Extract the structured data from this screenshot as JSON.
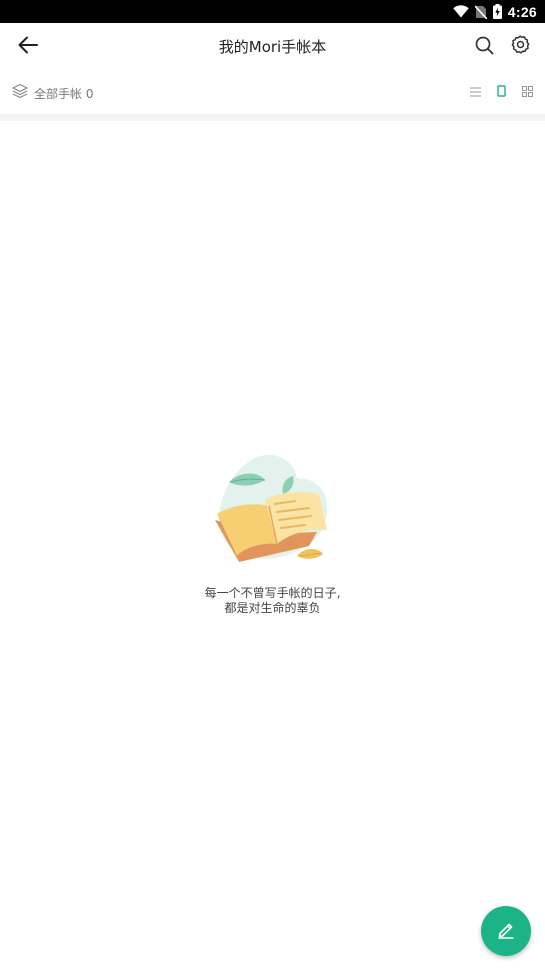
{
  "status_bar": {
    "time": "4:26",
    "icons": [
      "wifi-icon",
      "no-sim-icon",
      "battery-charging-icon"
    ]
  },
  "app_bar": {
    "back_icon": "arrow-left-icon",
    "title": "我的Mori手帐本",
    "search_icon": "search-icon",
    "settings_icon": "gear-icon"
  },
  "filter_bar": {
    "icon": "layers-icon",
    "label": "全部手帐 0",
    "views": [
      {
        "name": "list-view-icon",
        "active": false
      },
      {
        "name": "single-view-icon",
        "active": true
      },
      {
        "name": "grid-view-icon",
        "active": false
      }
    ]
  },
  "empty_state": {
    "illustration": "open-book-illustration",
    "line1": "每一个不曾写手帐的日子,",
    "line2": "都是对生命的辜负"
  },
  "fab": {
    "icon": "pen-icon",
    "color": "#1db389"
  },
  "colors": {
    "accent": "#1db389",
    "divider": "#f3f3f3"
  }
}
